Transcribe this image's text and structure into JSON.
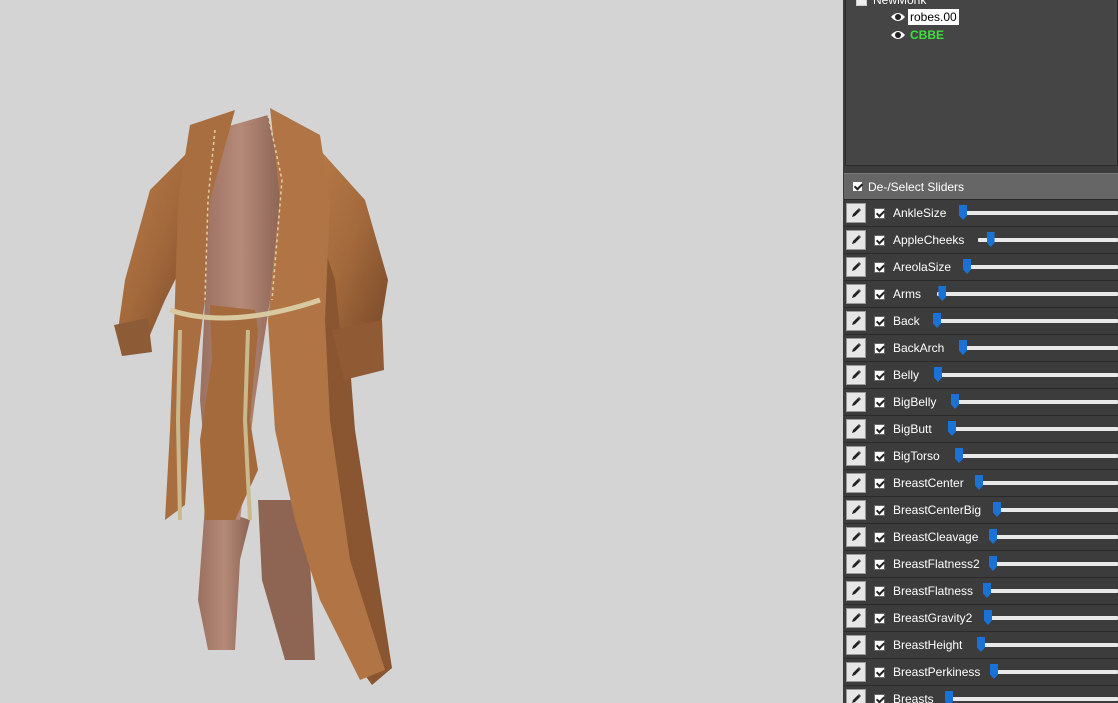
{
  "outline": {
    "project_name": "NewMonk",
    "meshes": [
      {
        "name": "robes.00",
        "selected": true,
        "reference": false
      },
      {
        "name": "CBBE",
        "selected": false,
        "reference": true
      }
    ]
  },
  "slider_panel": {
    "select_all_label": "De-/Select Sliders",
    "select_all_checked": true
  },
  "sliders": [
    {
      "name": "AnkleSize",
      "checked": true,
      "value": 0.01
    },
    {
      "name": "AppleCheeks",
      "checked": true,
      "value": 0.09
    },
    {
      "name": "AreolaSize",
      "checked": true,
      "value": 0.02
    },
    {
      "name": "Arms",
      "checked": true,
      "value": 0.03
    },
    {
      "name": "Back",
      "checked": true,
      "value": 0.02
    },
    {
      "name": "BackArch",
      "checked": true,
      "value": 0.01
    },
    {
      "name": "Belly",
      "checked": true,
      "value": 0.02
    },
    {
      "name": "BigBelly",
      "checked": true,
      "value": 0.02
    },
    {
      "name": "BigButt",
      "checked": true,
      "value": 0.01
    },
    {
      "name": "BigTorso",
      "checked": true,
      "value": 0.01
    },
    {
      "name": "BreastCenter",
      "checked": true,
      "value": 0.01
    },
    {
      "name": "BreastCenterBig",
      "checked": true,
      "value": 0.01
    },
    {
      "name": "BreastCleavage",
      "checked": true,
      "value": 0.01
    },
    {
      "name": "BreastFlatness2",
      "checked": true,
      "value": 0.01
    },
    {
      "name": "BreastFlatness",
      "checked": true,
      "value": 0.01
    },
    {
      "name": "BreastGravity2",
      "checked": true,
      "value": 0.01
    },
    {
      "name": "BreastHeight",
      "checked": true,
      "value": 0.01
    },
    {
      "name": "BreastPerkiness",
      "checked": true,
      "value": 0.01
    },
    {
      "name": "Breasts",
      "checked": true,
      "value": 0.01
    }
  ],
  "colors": {
    "viewport_bg": "#d4d4d4",
    "panel_bg": "#3c3c3c",
    "reference_text": "#3ee03e",
    "slider_thumb": "#1a72d6"
  },
  "icons": {
    "visibility": "eye-icon",
    "edit": "pencil-icon",
    "project": "project-icon"
  }
}
